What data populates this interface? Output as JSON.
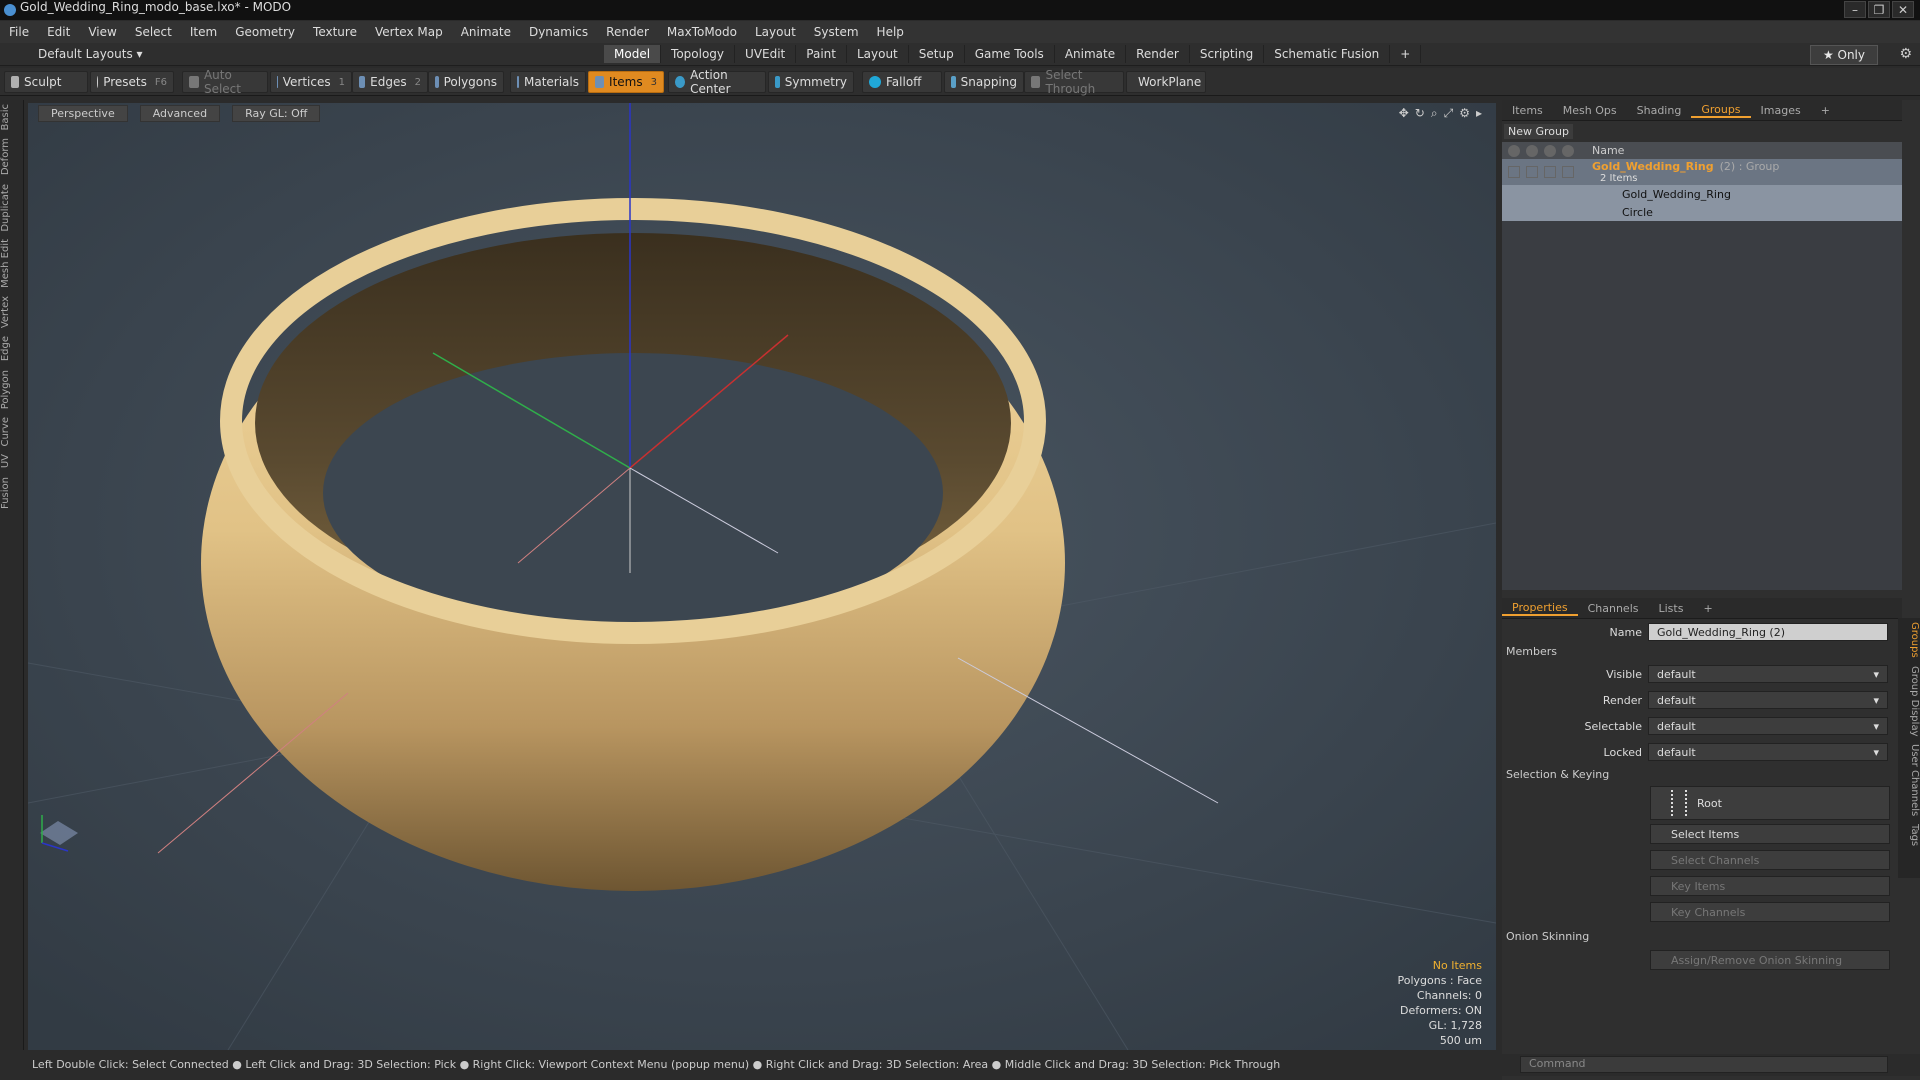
{
  "window": {
    "title": "Gold_Wedding_Ring_modo_base.lxo* - MODO"
  },
  "menu": [
    "File",
    "Edit",
    "View",
    "Select",
    "Item",
    "Geometry",
    "Texture",
    "Vertex Map",
    "Animate",
    "Dynamics",
    "Render",
    "MaxToModo",
    "Layout",
    "System",
    "Help"
  ],
  "layout": {
    "default_layouts": "Default Layouts ▾",
    "tabs": [
      "Model",
      "Topology",
      "UVEdit",
      "Paint",
      "Layout",
      "Setup",
      "Game Tools",
      "Animate",
      "Render",
      "Scripting",
      "Schematic Fusion",
      "+"
    ],
    "active_tab": "Model",
    "only": "★  Only"
  },
  "toolbar": {
    "sculpt": "Sculpt",
    "presets": "Presets",
    "presets_key": "F6",
    "auto_select": "Auto Select",
    "vertices": "Vertices",
    "vertices_count": "1",
    "edges": "Edges",
    "edges_count": "2",
    "polygons": "Polygons",
    "materials": "Materials",
    "items": "Items",
    "items_count": "3",
    "action_center": "Action Center",
    "symmetry": "Symmetry",
    "falloff": "Falloff",
    "snapping": "Snapping",
    "select_through": "Select Through",
    "workplane": "WorkPlane"
  },
  "left_tabs": [
    "Basic",
    "Deform",
    "Duplicate",
    "Mesh Edit",
    "Vertex",
    "Edge",
    "Polygon",
    "Curve",
    "UV",
    "Fusion"
  ],
  "viewport": {
    "perspective": "Perspective",
    "advanced": "Advanced",
    "raygl": "Ray GL: Off",
    "stats": {
      "no_items": "No Items",
      "polygons": "Polygons : Face",
      "channels": "Channels: 0",
      "deformers": "Deformers: ON",
      "gl": "GL: 1,728",
      "scale": "500 um"
    }
  },
  "status": "Left Double Click: Select Connected ● Left Click and Drag: 3D Selection: Pick ● Right Click: Viewport Context Menu (popup menu) ● Right Click and Drag: 3D Selection: Area ● Middle Click and Drag: 3D Selection: Pick Through",
  "groups_panel": {
    "tabs": [
      "Items",
      "Mesh Ops",
      "Shading",
      "Groups",
      "Images",
      "+"
    ],
    "active": "Groups",
    "new_group": "New Group",
    "col_name": "Name",
    "group_name": "Gold_Wedding_Ring",
    "group_suffix": "(2) : Group",
    "group_count": "2 Items",
    "children": [
      "Gold_Wedding_Ring",
      "Circle"
    ]
  },
  "properties": {
    "tabs": [
      "Properties",
      "Channels",
      "Lists",
      "+"
    ],
    "active": "Properties",
    "name_label": "Name",
    "name_value": "Gold_Wedding_Ring (2)",
    "members": "Members",
    "visible_label": "Visible",
    "visible_value": "default",
    "render_label": "Render",
    "render_value": "default",
    "selectable_label": "Selectable",
    "selectable_value": "default",
    "locked_label": "Locked",
    "locked_value": "default",
    "selection_keying": "Selection & Keying",
    "root": "Root",
    "select_items": "Select Items",
    "select_channels": "Select Channels",
    "key_items": "Key Items",
    "key_channels": "Key Channels",
    "onion": "Onion Skinning",
    "assign_onion": "Assign/Remove Onion Skinning"
  },
  "side_tabs": [
    "Groups",
    "Group Display",
    "User Channels",
    "Tags"
  ],
  "command_placeholder": "Command",
  "colors": {
    "accent": "#f0a030",
    "gold": "#d8b577"
  }
}
